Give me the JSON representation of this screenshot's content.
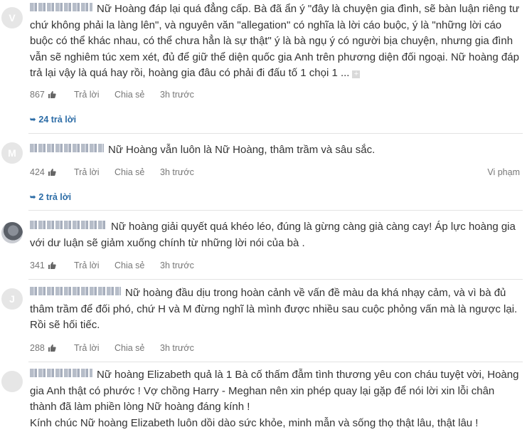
{
  "comments": [
    {
      "avatar_letter": "V",
      "text": "Nữ Hoàng đáp lại quá đẳng cấp. Bà đã ẩn ý \"đây là chuyện gia đình, sẽ bàn luận riêng tư chứ không phải la làng lên\", và nguyên văn \"allegation\" có nghĩa là lời cáo buộc, ý là \"những lời cáo buộc có thể khác nhau, có thể chưa hẳn là sự thật\" ý là bà ngụ ý có người bịa chuyện, nhưng gia đình vẫn sẽ nghiêm túc xem xét, đủ để giữ thể diện quốc gia Anh trên phương diện đối ngoại. Nữ hoàng đáp trả lại vậy là quá hay rồi, hoàng gia đâu có phải đi đấu tố 1 chọi 1",
      "ellipsis": "...",
      "likes": "867",
      "reply_label": "Trả lời",
      "share_label": "Chia sẻ",
      "time": "3h trước",
      "replies": "24 trả lời"
    },
    {
      "avatar_letter": "M",
      "text": "Nữ Hoàng vẫn luôn là Nữ Hoàng, thâm trầm và sâu sắc.",
      "likes": "424",
      "reply_label": "Trả lời",
      "share_label": "Chia sẻ",
      "time": "3h trước",
      "report_label": "Vi phạm",
      "replies": "2 trả lời"
    },
    {
      "avatar_letter": "",
      "text": "Nữ hoàng giải quyết quá khéo léo, đúng là gừng càng già càng cay! Áp lực hoàng gia với dư luận sẽ giảm xuống chính từ những lời nói của bà .",
      "likes": "341",
      "reply_label": "Trả lời",
      "share_label": "Chia sẻ",
      "time": "3h trước"
    },
    {
      "avatar_letter": "J",
      "text": "Nữ hoàng đầu dịu trong hoàn cảnh về vấn đề màu da khá nhạy cảm, và vì bà đủ thâm trầm để đối phó, chứ H và M đừng nghĩ là mình được nhiều sau cuộc phỏng vấn mà là ngược lại. Rồi sẽ hối tiếc.",
      "likes": "288",
      "reply_label": "Trả lời",
      "share_label": "Chia sẻ",
      "time": "3h trước"
    },
    {
      "avatar_letter": "",
      "text_lines": [
        "Nữ hoàng Elizabeth quả là 1 Bà cố thấm đẫm tình thương yêu con cháu tuyệt vời, Hoàng gia Anh thật có phước ! Vợ chồng Harry - Meghan nên xin phép quay lại gặp để nói lời xin lỗi chân thành đã làm phiền lòng Nữ hoàng đáng kính !",
        "Kính chúc Nữ hoàng Elizabeth luôn dồi dào sức khỏe, minh mẫn và sống thọ thật lâu, thật lâu !"
      ]
    }
  ],
  "icons": {
    "like": "thumbs-up-icon",
    "expand": "expand-plus-icon",
    "replies_arrow": "reply-arrow-icon"
  },
  "colors": {
    "reply_link": "#2c6ca6",
    "meta_text": "#777777",
    "avatar_bg": "#e6e6e6"
  }
}
